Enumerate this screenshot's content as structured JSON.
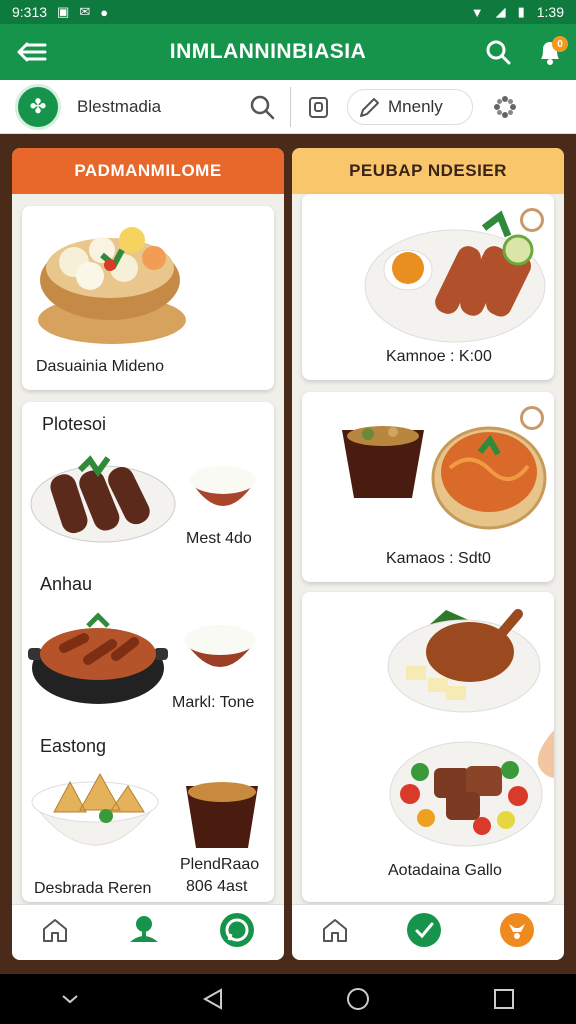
{
  "status": {
    "time": "9:313",
    "clock": "1:39"
  },
  "app_bar": {
    "title": "INMLANNINBIASIA",
    "notif_count": "0"
  },
  "search_row": {
    "search_text": "Blestmadia",
    "menu_text": "Mnenly"
  },
  "left_panel": {
    "header": "PADMANMILOME",
    "top_card_caption": "Dasuainia Mideno",
    "sections": [
      {
        "title": "Plotesoi",
        "caption": "Mest 4do"
      },
      {
        "title": "Anhau",
        "caption": "Markl: Tone"
      },
      {
        "title": "Eastong",
        "caption_left": "Desbrada Reren",
        "caption_right_1": "PlendRaao",
        "caption_right_2": "806 4ast"
      }
    ]
  },
  "right_panel": {
    "header": "PEUBAP NDESIER",
    "cards": [
      {
        "caption": "Kamnoe : K:00"
      },
      {
        "caption": "Kamaos : Sdt0"
      },
      {
        "caption": "Aotadaina Gallo"
      }
    ]
  },
  "icons": {
    "menu": "menu-arrow-icon",
    "search": "search-icon",
    "bell": "bell-icon",
    "home": "home-icon",
    "tree": "tree-icon",
    "whatsapp": "whatsapp-icon",
    "fox": "fox-icon",
    "hand": "hand-icon"
  },
  "colors": {
    "brand_green": "#16944b",
    "status_green": "#0f7a3d",
    "orange": "#e8672a",
    "yellow": "#f9c66b",
    "brown": "#4a2a19"
  }
}
